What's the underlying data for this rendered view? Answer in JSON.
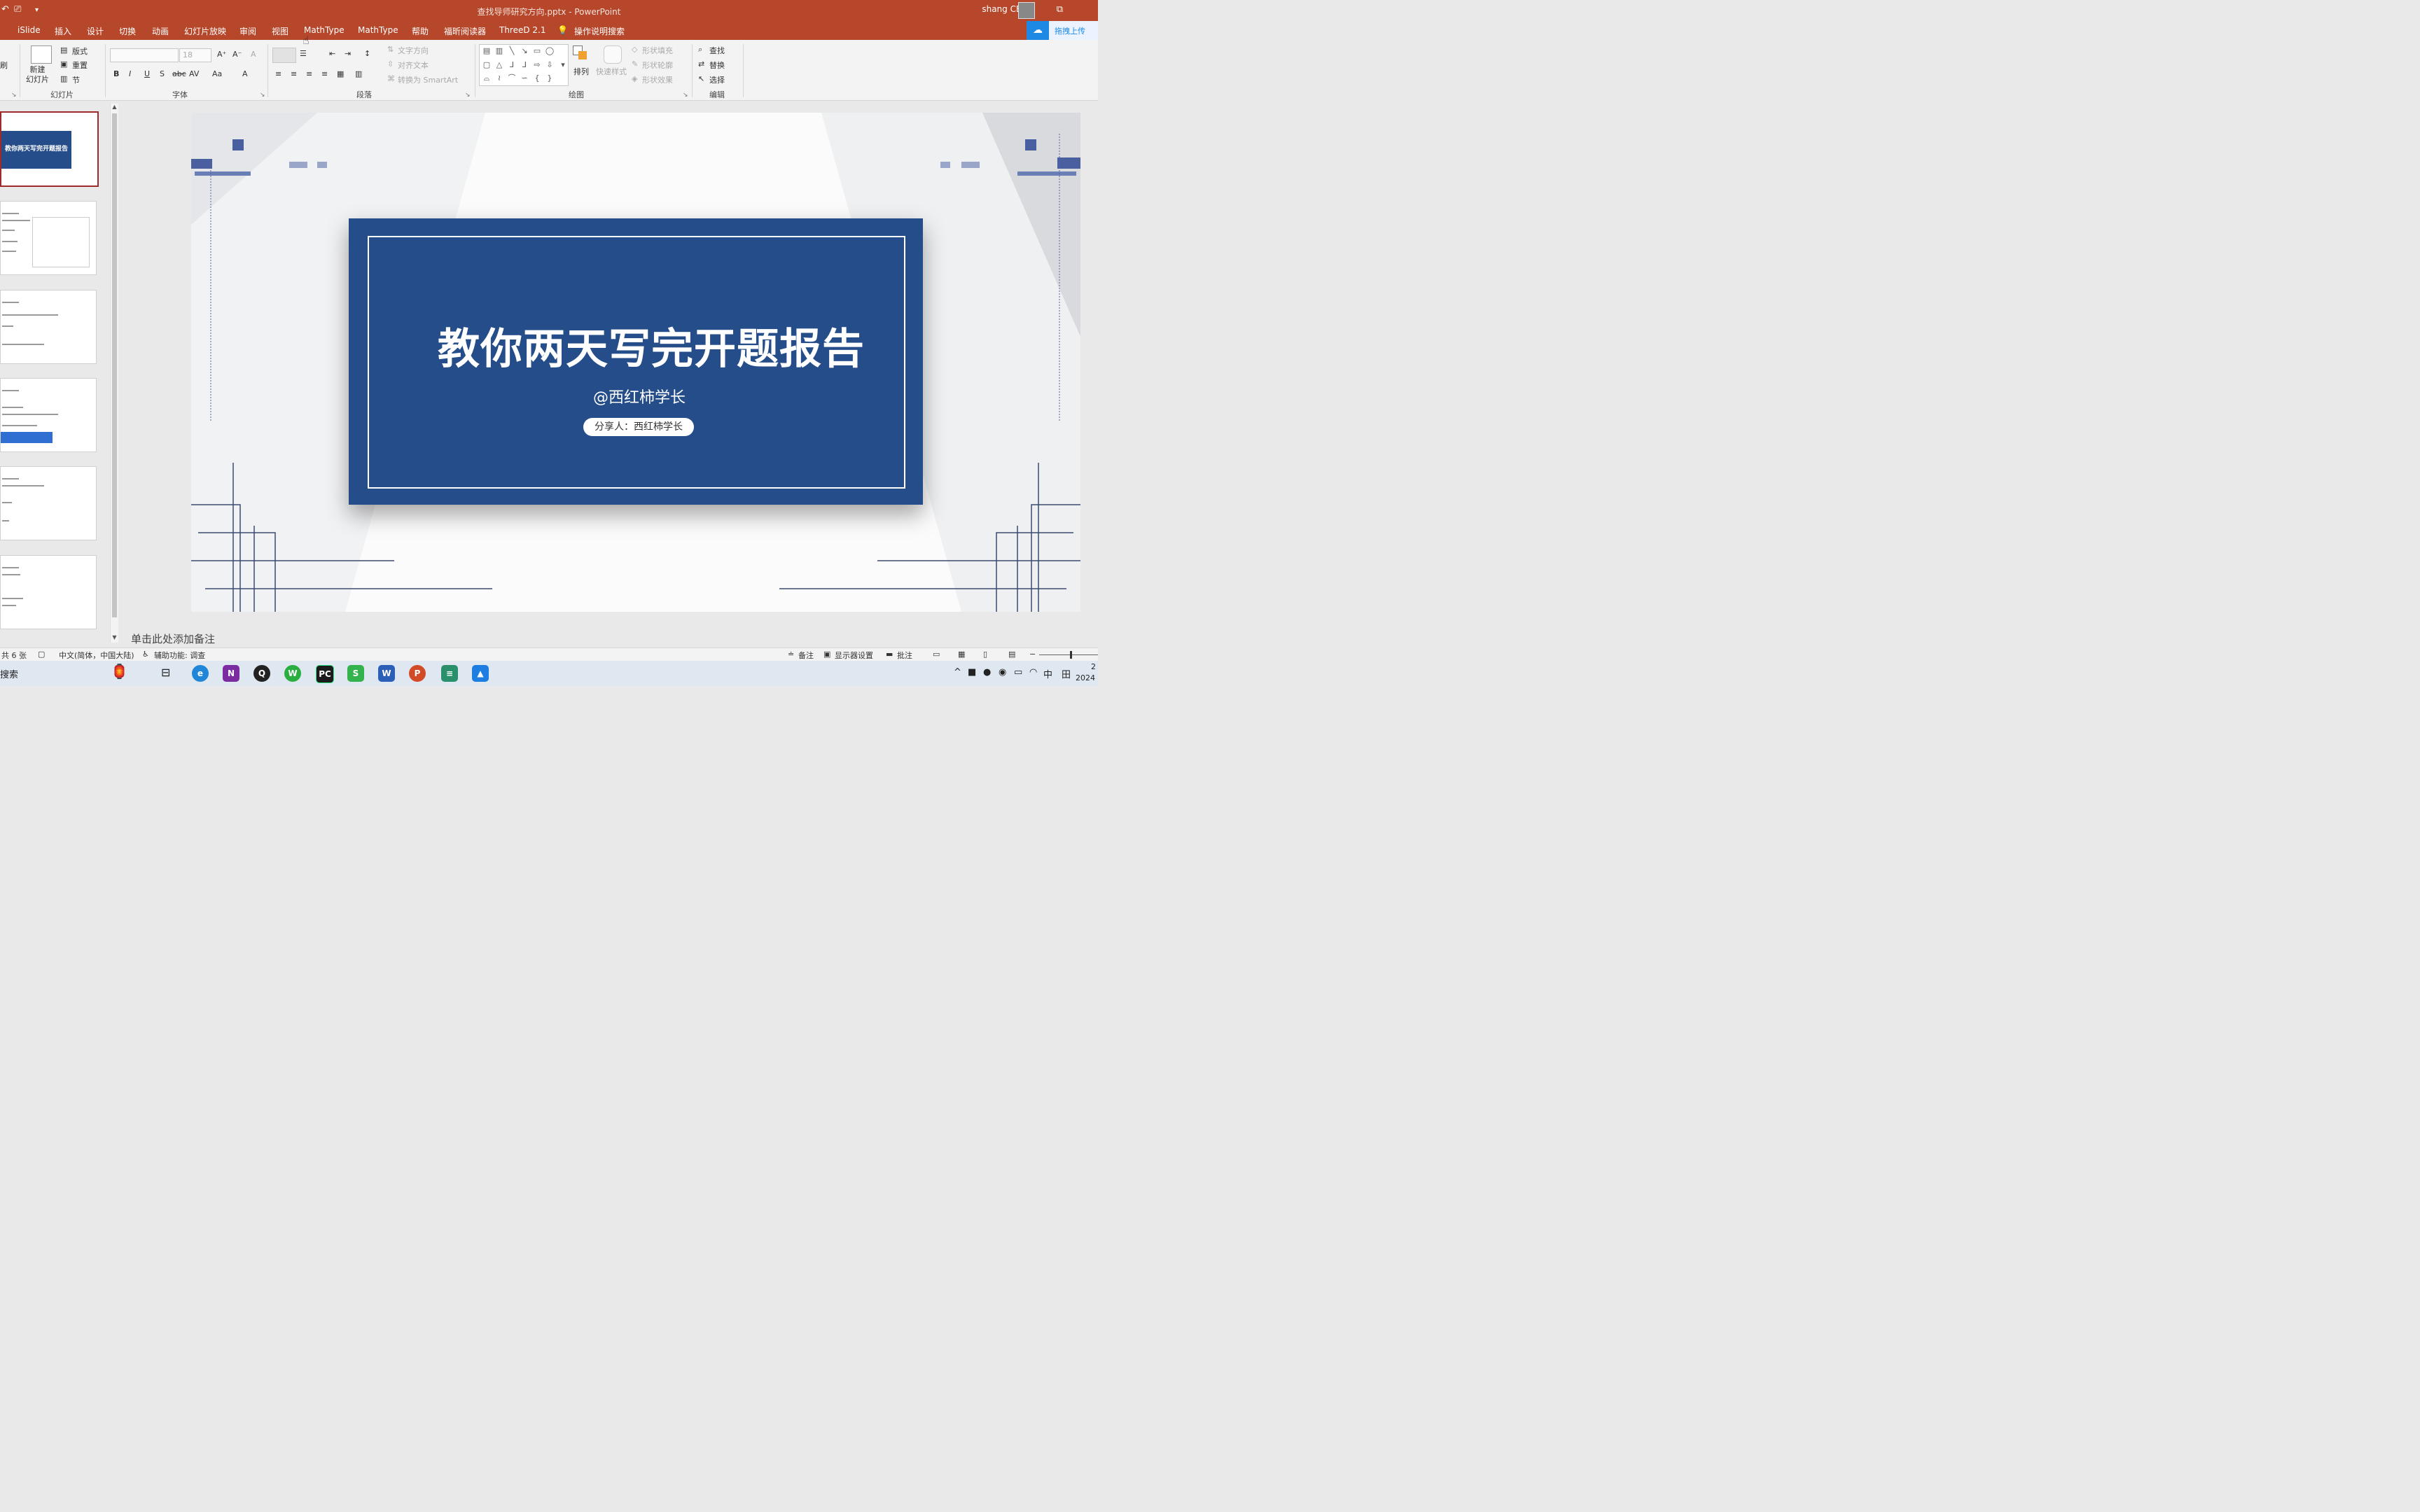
{
  "window": {
    "title": "查找导师研究方向.pptx - PowerPoint",
    "user_name": "shang CEO"
  },
  "quick_access": {
    "undo": "↶",
    "present": "⎚",
    "customize": "▾"
  },
  "tabs": [
    "iSlide",
    "插入",
    "设计",
    "切换",
    "动画",
    "幻灯片放映",
    "审阅",
    "视图",
    "MathType",
    "MathType",
    "帮助",
    "福昕阅读器",
    "ThreeD 2.1",
    "操作说明搜索"
  ],
  "cloud_upload": {
    "label": "拖拽上传"
  },
  "ribbon": {
    "clipboard_partial": "刷",
    "slides": {
      "new_slide": "新建\n幻灯片",
      "layout": "版式",
      "reset": "重置",
      "section": "节",
      "group": "幻灯片"
    },
    "font": {
      "size": "18",
      "group": "字体",
      "bold": "B",
      "italic": "I",
      "underline": "U",
      "shadow": "S",
      "strike": "abc",
      "spacing": "AV",
      "case": "Aa",
      "color": "A",
      "grow": "A⁺",
      "shrink": "A⁻",
      "clear": "A"
    },
    "paragraph": {
      "text_direction": "文字方向",
      "align_text": "对齐文本",
      "smartart": "转换为 SmartArt",
      "group": "段落"
    },
    "drawing": {
      "arrange": "排列",
      "quick_styles": "快速样式",
      "fill": "形状填充",
      "outline": "形状轮廓",
      "effects": "形状效果",
      "group": "绘图"
    },
    "editing": {
      "find": "查找",
      "replace": "替换",
      "select": "选择",
      "group": "编辑"
    }
  },
  "slide": {
    "title": "教你两天写完开题报告",
    "subtitle": "@西红柿学长",
    "presenter": "分享人：西红柿学长",
    "background_color": "#fbfbfb",
    "card_color": "#254d89"
  },
  "thumbnails": {
    "first_title": "教你两天写完开题报告",
    "count": 6
  },
  "notes": {
    "placeholder": "单击此处添加备注"
  },
  "status": {
    "slide_count": "共 6 张",
    "language": "中文(简体，中国大陆)",
    "accessibility": "辅助功能: 调查",
    "notes": "备注",
    "display_settings": "显示器设置",
    "comments": "批注"
  },
  "taskbar": {
    "search": "搜索",
    "apps": [
      "edge",
      "onenote",
      "qq",
      "wechat",
      "pycharm",
      "wps",
      "word",
      "powerpoint",
      "app",
      "app2"
    ],
    "ime": "中",
    "time": "2",
    "date": "2024"
  }
}
